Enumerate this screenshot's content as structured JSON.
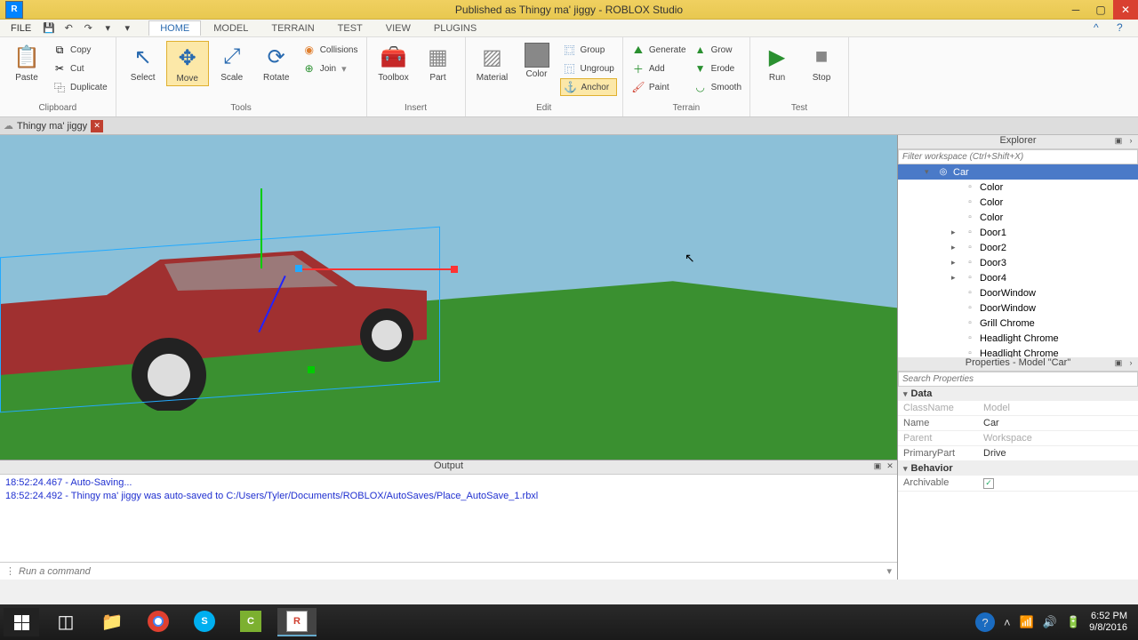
{
  "window": {
    "title": "Published as Thingy ma' jiggy - ROBLOX Studio"
  },
  "menu": {
    "file": "FILE",
    "tabs": [
      "HOME",
      "MODEL",
      "TERRAIN",
      "TEST",
      "VIEW",
      "PLUGINS"
    ],
    "active_tab": 0
  },
  "ribbon": {
    "clipboard": {
      "label": "Clipboard",
      "paste": "Paste",
      "copy": "Copy",
      "cut": "Cut",
      "duplicate": "Duplicate"
    },
    "tools": {
      "label": "Tools",
      "select": "Select",
      "move": "Move",
      "scale": "Scale",
      "rotate": "Rotate",
      "collisions": "Collisions",
      "join": "Join"
    },
    "insert": {
      "label": "Insert",
      "toolbox": "Toolbox",
      "part": "Part"
    },
    "edit": {
      "label": "Edit",
      "material": "Material",
      "color": "Color",
      "group": "Group",
      "ungroup": "Ungroup",
      "anchor": "Anchor"
    },
    "terrain": {
      "label": "Terrain",
      "generate": "Generate",
      "add": "Add",
      "paint": "Paint",
      "grow": "Grow",
      "erode": "Erode",
      "smooth": "Smooth"
    },
    "test": {
      "label": "Test",
      "run": "Run",
      "stop": "Stop"
    }
  },
  "document": {
    "name": "Thingy ma' jiggy"
  },
  "explorer": {
    "title": "Explorer",
    "filter_placeholder": "Filter workspace (Ctrl+Shift+X)",
    "items": [
      {
        "name": "Car",
        "selected": true,
        "expandable": true,
        "level": 0,
        "icon": "model"
      },
      {
        "name": "Color",
        "level": 1,
        "icon": "part"
      },
      {
        "name": "Color",
        "level": 1,
        "icon": "part"
      },
      {
        "name": "Color",
        "level": 1,
        "icon": "part"
      },
      {
        "name": "Door1",
        "level": 1,
        "icon": "part",
        "expandable": true
      },
      {
        "name": "Door2",
        "level": 1,
        "icon": "part",
        "expandable": true
      },
      {
        "name": "Door3",
        "level": 1,
        "icon": "part",
        "expandable": true
      },
      {
        "name": "Door4",
        "level": 1,
        "icon": "part",
        "expandable": true
      },
      {
        "name": "DoorWindow",
        "level": 1,
        "icon": "part"
      },
      {
        "name": "DoorWindow",
        "level": 1,
        "icon": "part"
      },
      {
        "name": "Grill Chrome",
        "level": 1,
        "icon": "part"
      },
      {
        "name": "Headlight Chrome",
        "level": 1,
        "icon": "part"
      },
      {
        "name": "Headlight Chrome",
        "level": 1,
        "icon": "part"
      }
    ]
  },
  "properties": {
    "title": "Properties - Model \"Car\"",
    "search_placeholder": "Search Properties",
    "sections": [
      {
        "name": "Data",
        "rows": [
          {
            "k": "ClassName",
            "v": "Model",
            "ro": true
          },
          {
            "k": "Name",
            "v": "Car"
          },
          {
            "k": "Parent",
            "v": "Workspace",
            "ro": true
          },
          {
            "k": "PrimaryPart",
            "v": "Drive"
          }
        ]
      },
      {
        "name": "Behavior",
        "rows": [
          {
            "k": "Archivable",
            "v": "[check]"
          }
        ]
      }
    ]
  },
  "output": {
    "title": "Output",
    "lines": [
      "18:52:24.467 - Auto-Saving...",
      "18:52:24.492 - Thingy ma' jiggy was auto-saved to C:/Users/Tyler/Documents/ROBLOX/AutoSaves/Place_AutoSave_1.rbxl"
    ],
    "cmd_placeholder": "Run a command"
  },
  "taskbar": {
    "time": "6:52 PM",
    "date": "9/8/2016"
  }
}
